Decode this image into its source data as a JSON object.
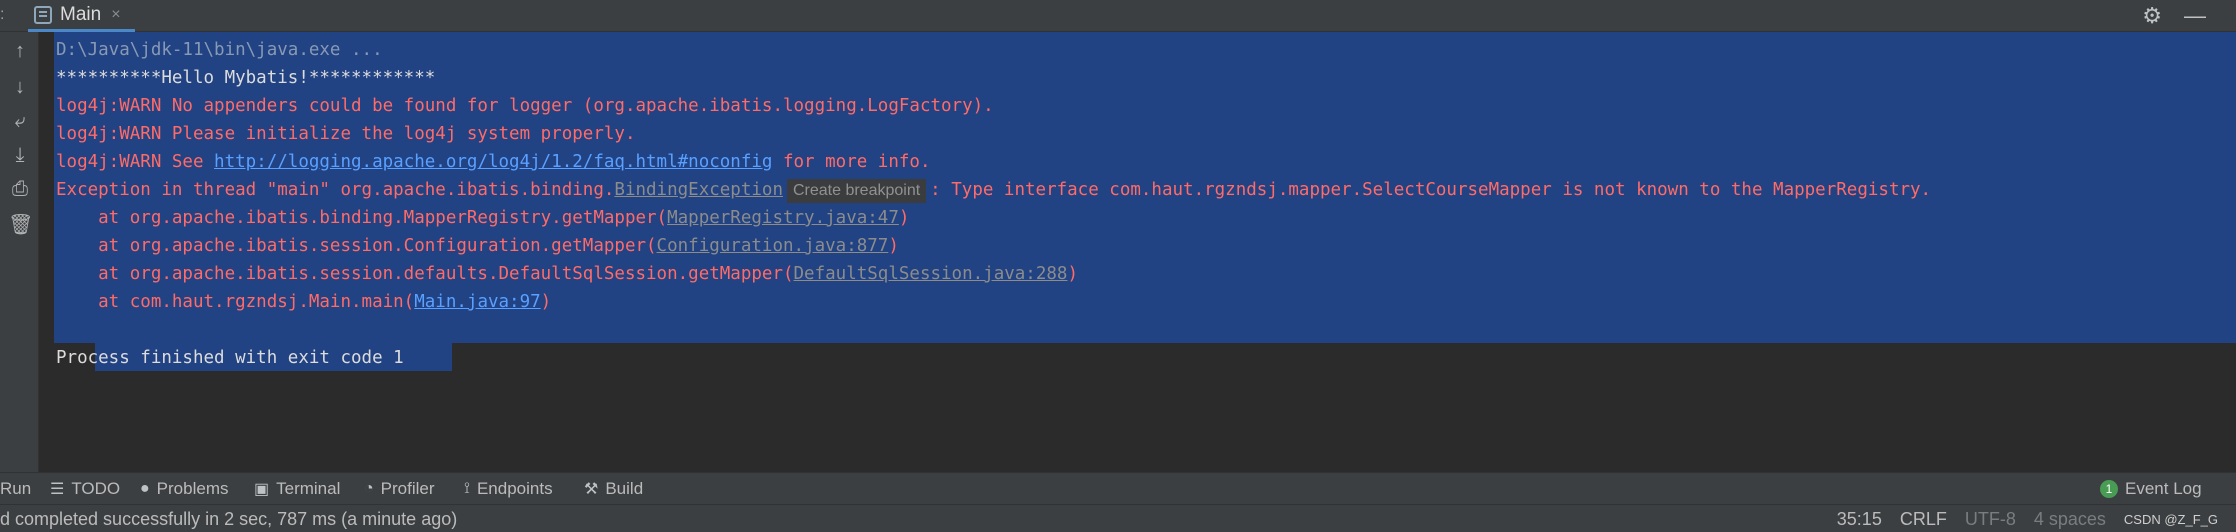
{
  "tab": {
    "label": "Main",
    "close": "×"
  },
  "header_icons": {
    "settings": "⚙",
    "minimize": "—"
  },
  "toolstrip": [
    "↑",
    "↓",
    "⤶",
    "⤓",
    "⎙",
    "🗑"
  ],
  "console": {
    "l1": "D:\\Java\\jdk-11\\bin\\java.exe ...",
    "l2": "**********Hello Mybatis!************",
    "l3": "log4j:WARN No appenders could be found for logger (org.apache.ibatis.logging.LogFactory).",
    "l4": "log4j:WARN Please initialize the log4j system properly.",
    "l5_a": "log4j:WARN See ",
    "l5_link": "http://logging.apache.org/log4j/1.2/faq.html#noconfig",
    "l5_b": " for more info.",
    "l6_a": "Exception in thread \"main\" org.apache.ibatis.binding.",
    "l6_link": "BindingException",
    "l6_tip": "Create breakpoint",
    "l6_b": ": Type interface com.haut.rgzndsj.mapper.SelectCourseMapper is not known to the MapperRegistry.",
    "st1_a": "    at org.apache.ibatis.binding.MapperRegistry.getMapper(",
    "st1_link": "MapperRegistry.java:47",
    "st1_b": ")",
    "st2_a": "    at org.apache.ibatis.session.Configuration.getMapper(",
    "st2_link": "Configuration.java:877",
    "st2_b": ")",
    "st3_a": "    at org.apache.ibatis.session.defaults.DefaultSqlSession.getMapper(",
    "st3_link": "DefaultSqlSession.java:288",
    "st3_b": ")",
    "st4_a": "    at com.haut.rgzndsj.Main.main(",
    "st4_link": "Main.java:97",
    "st4_b": ")",
    "exit": "Process finished with exit code 1"
  },
  "bottom_tools": {
    "run": "Run",
    "todo": "TODO",
    "problems": "Problems",
    "terminal": "Terminal",
    "profiler": "Profiler",
    "endpoints": "Endpoints",
    "build": "Build",
    "event_count": "1",
    "event_log": "Event Log"
  },
  "status": {
    "message": "d completed successfully in 2 sec, 787 ms (a minute ago)",
    "position": "35:15",
    "line_sep": "CRLF",
    "encoding": "UTF-8",
    "indent": "4 spaces",
    "watermark": "CSDN @Z_F_G"
  }
}
